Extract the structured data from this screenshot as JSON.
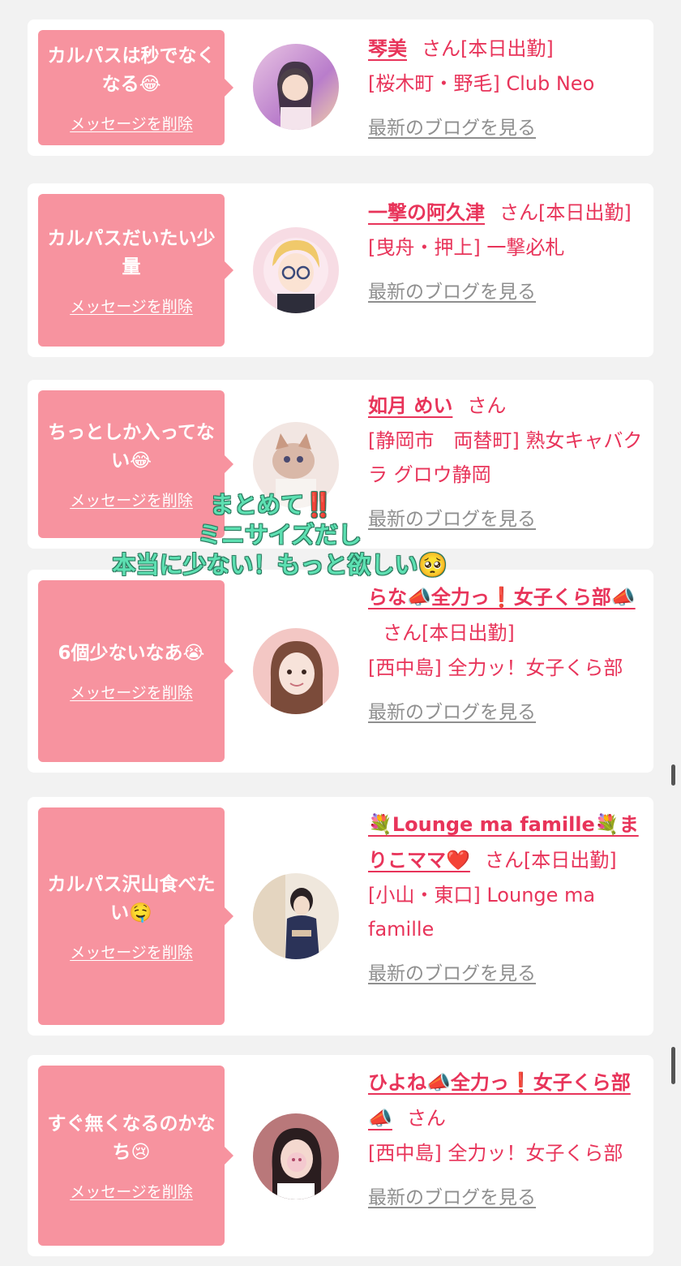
{
  "delete_label": "メッセージを削除",
  "blog_label": "最新のブログを見る",
  "cards": [
    {
      "message": "カルパスは秒でなくなる😂",
      "name": "琴美",
      "suffix": "さん[本日出勤]",
      "shop": "[桜木町・野毛] Club Neo",
      "avatar_colors": [
        "#e9c5e3",
        "#b97dcb",
        "#f3d2a6"
      ]
    },
    {
      "message": "カルパスだいたい少量",
      "name": "一撃の阿久津",
      "suffix": "さん[本日出勤]",
      "shop": "[曳舟・押上] 一撃必札",
      "avatar_colors": [
        "#f7dce4",
        "#f0c96b",
        "#3b4a7a"
      ]
    },
    {
      "message": "ちっとしか入ってない😂",
      "name": "如月 めい",
      "suffix": "さん",
      "shop": "[静岡市　両替町] 熟女キャバクラ グロウ静岡",
      "avatar_colors": [
        "#f2e6e2",
        "#d9b8a8",
        "#c99a83"
      ]
    },
    {
      "message": "6個少ないなあ😭",
      "name": "らな📣全力っ❗️女子くら部📣",
      "suffix": "さん[本日出勤]",
      "shop": "[西中島] 全力ッ！女子くら部",
      "avatar_colors": [
        "#f3c7c4",
        "#7b4b3a",
        "#f7e3da"
      ]
    },
    {
      "message": "カルパス沢山食べたい🤤",
      "name": "💐Lounge ma famille💐まりこママ❤️",
      "suffix": "さん[本日出勤]",
      "shop": "[小山・東口] Lounge ma famille",
      "avatar_colors": [
        "#efe7dc",
        "#2b3358",
        "#d9c2a6"
      ]
    },
    {
      "message": "すぐ無くなるのかなち😢",
      "name": "ひよね📣全力っ❗️女子くら部📣",
      "suffix": "さん",
      "shop": "[西中島] 全力ッ！女子くら部",
      "avatar_colors": [
        "#b9787a",
        "#2a1d1f",
        "#f4c9cf"
      ]
    }
  ],
  "overlay": {
    "line1": "まとめて‼️",
    "line2": "ミニサイズだし",
    "line3": "本当に少ない！もっと欲しい🥺"
  }
}
